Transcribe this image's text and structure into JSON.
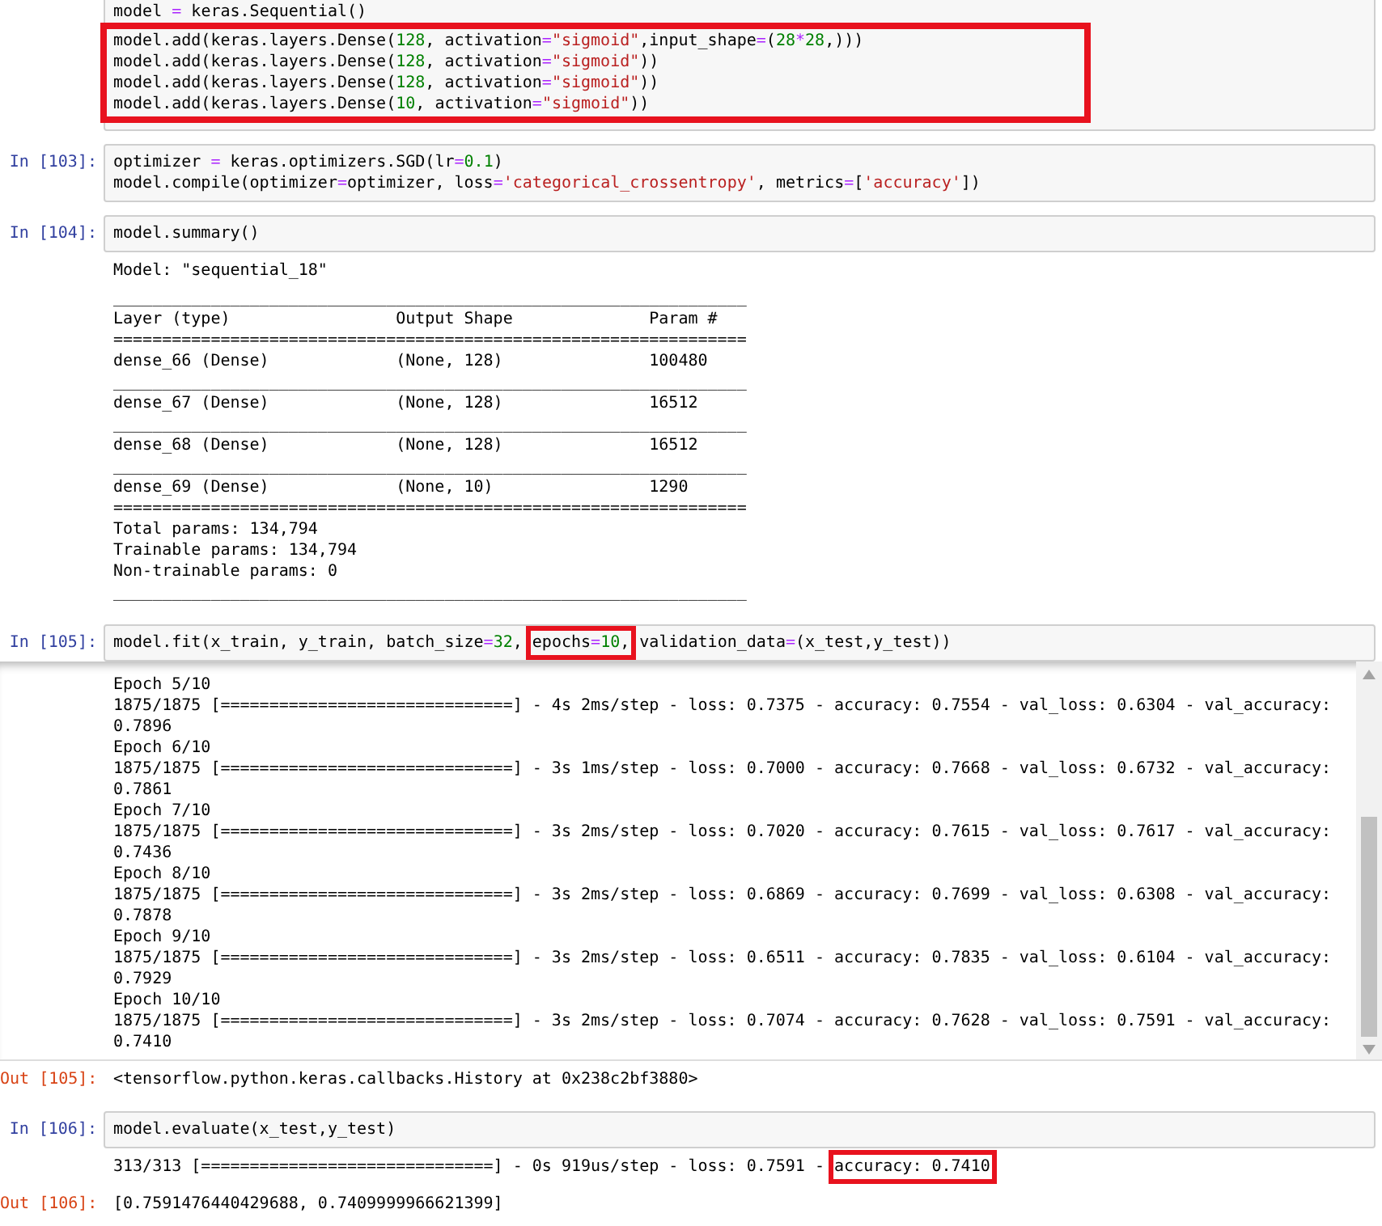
{
  "cells": [
    {
      "code": [
        {
          "highlighted": false,
          "segments": [
            {
              "text": "model ",
              "kind": "plain"
            },
            {
              "text": "=",
              "kind": "op"
            },
            {
              "text": " keras.Sequential()",
              "kind": "plain"
            }
          ]
        },
        {
          "highlighted": true,
          "segments": [
            {
              "text": "model.add(keras.layers.Dense(",
              "kind": "plain"
            },
            {
              "text": "128",
              "kind": "num"
            },
            {
              "text": ", activation",
              "kind": "plain"
            },
            {
              "text": "=",
              "kind": "op"
            },
            {
              "text": "\"sigmoid\"",
              "kind": "str"
            },
            {
              "text": ",input_shape",
              "kind": "plain"
            },
            {
              "text": "=",
              "kind": "op"
            },
            {
              "text": "(",
              "kind": "plain"
            },
            {
              "text": "28",
              "kind": "num"
            },
            {
              "text": "*",
              "kind": "op"
            },
            {
              "text": "28",
              "kind": "num"
            },
            {
              "text": ",)))",
              "kind": "plain"
            }
          ]
        },
        {
          "highlighted": true,
          "segments": [
            {
              "text": "model.add(keras.layers.Dense(",
              "kind": "plain"
            },
            {
              "text": "128",
              "kind": "num"
            },
            {
              "text": ", activation",
              "kind": "plain"
            },
            {
              "text": "=",
              "kind": "op"
            },
            {
              "text": "\"sigmoid\"",
              "kind": "str"
            },
            {
              "text": "))",
              "kind": "plain"
            }
          ]
        },
        {
          "highlighted": true,
          "segments": [
            {
              "text": "model.add(keras.layers.Dense(",
              "kind": "plain"
            },
            {
              "text": "128",
              "kind": "num"
            },
            {
              "text": ", activation",
              "kind": "plain"
            },
            {
              "text": "=",
              "kind": "op"
            },
            {
              "text": "\"sigmoid\"",
              "kind": "str"
            },
            {
              "text": "))",
              "kind": "plain"
            }
          ]
        },
        {
          "highlighted": true,
          "segments": [
            {
              "text": "model.add(keras.layers.Dense(",
              "kind": "plain"
            },
            {
              "text": "10",
              "kind": "num"
            },
            {
              "text": ", activation",
              "kind": "plain"
            },
            {
              "text": "=",
              "kind": "op"
            },
            {
              "text": "\"sigmoid\"",
              "kind": "str"
            },
            {
              "text": "))",
              "kind": "plain"
            }
          ]
        }
      ]
    },
    {
      "prompt": "In [103]:",
      "code": [
        {
          "highlighted": false,
          "segments": [
            {
              "text": "optimizer ",
              "kind": "plain"
            },
            {
              "text": "=",
              "kind": "op"
            },
            {
              "text": " keras.optimizers.SGD(lr",
              "kind": "plain"
            },
            {
              "text": "=",
              "kind": "op"
            },
            {
              "text": "0.1",
              "kind": "num"
            },
            {
              "text": ")",
              "kind": "plain"
            }
          ]
        },
        {
          "highlighted": false,
          "segments": [
            {
              "text": "model.compile(optimizer",
              "kind": "plain"
            },
            {
              "text": "=",
              "kind": "op"
            },
            {
              "text": "optimizer, loss",
              "kind": "plain"
            },
            {
              "text": "=",
              "kind": "op"
            },
            {
              "text": "'categorical_crossentropy'",
              "kind": "str"
            },
            {
              "text": ", metrics",
              "kind": "plain"
            },
            {
              "text": "=",
              "kind": "op"
            },
            {
              "text": "[",
              "kind": "plain"
            },
            {
              "text": "'accuracy'",
              "kind": "str"
            },
            {
              "text": "])",
              "kind": "plain"
            }
          ]
        }
      ]
    },
    {
      "prompt": "In [104]:",
      "code": [
        {
          "highlighted": false,
          "segments": [
            {
              "text": "model.summary()",
              "kind": "plain"
            }
          ]
        }
      ],
      "outputs": [
        {
          "kind": "stream",
          "lines": [
            "Model: \"sequential_18\"",
            "_________________________________________________________________",
            "Layer (type)                 Output Shape              Param #   ",
            "=================================================================",
            "dense_66 (Dense)             (None, 128)               100480    ",
            "_________________________________________________________________",
            "dense_67 (Dense)             (None, 128)               16512     ",
            "_________________________________________________________________",
            "dense_68 (Dense)             (None, 128)               16512     ",
            "_________________________________________________________________",
            "dense_69 (Dense)             (None, 10)                1290      ",
            "=================================================================",
            "Total params: 134,794",
            "Trainable params: 134,794",
            "Non-trainable params: 0",
            "_________________________________________________________________"
          ]
        }
      ]
    },
    {
      "prompt": "In [105]:",
      "code": [
        {
          "highlighted": false,
          "segments": [
            {
              "text": "model.fit(x_train, y_train, batch_size",
              "kind": "plain"
            },
            {
              "text": "=",
              "kind": "op"
            },
            {
              "text": "32",
              "kind": "num"
            },
            {
              "text": ", ",
              "kind": "plain"
            },
            {
              "kind": "box",
              "parts": [
                {
                  "text": "epochs",
                  "kind": "plain"
                },
                {
                  "text": "=",
                  "kind": "op"
                },
                {
                  "text": "10",
                  "kind": "num"
                },
                {
                  "text": ",",
                  "kind": "plain"
                }
              ]
            },
            {
              "text": " validation_data",
              "kind": "plain"
            },
            {
              "text": "=",
              "kind": "op"
            },
            {
              "text": "(x_test,y_test))",
              "kind": "plain"
            }
          ]
        }
      ],
      "outputs": [
        {
          "kind": "scrolled",
          "lines": [
            "Epoch 5/10",
            "1875/1875 [==============================] - 4s 2ms/step - loss: 0.7375 - accuracy: 0.7554 - val_loss: 0.6304 - val_accuracy:",
            "0.7896",
            "Epoch 6/10",
            "1875/1875 [==============================] - 3s 1ms/step - loss: 0.7000 - accuracy: 0.7668 - val_loss: 0.6732 - val_accuracy:",
            "0.7861",
            "Epoch 7/10",
            "1875/1875 [==============================] - 3s 2ms/step - loss: 0.7020 - accuracy: 0.7615 - val_loss: 0.7617 - val_accuracy:",
            "0.7436",
            "Epoch 8/10",
            "1875/1875 [==============================] - 3s 2ms/step - loss: 0.6869 - accuracy: 0.7699 - val_loss: 0.6308 - val_accuracy:",
            "0.7878",
            "Epoch 9/10",
            "1875/1875 [==============================] - 3s 2ms/step - loss: 0.6511 - accuracy: 0.7835 - val_loss: 0.6104 - val_accuracy:",
            "0.7929",
            "Epoch 10/10",
            "1875/1875 [==============================] - 3s 2ms/step - loss: 0.7074 - accuracy: 0.7628 - val_loss: 0.7591 - val_accuracy:",
            "0.7410"
          ]
        },
        {
          "kind": "result",
          "prompt": "Out [105]:",
          "lines": [
            "<tensorflow.python.keras.callbacks.History at 0x238c2bf3880>"
          ]
        }
      ]
    },
    {
      "prompt": "In [106]:",
      "code": [
        {
          "highlighted": false,
          "segments": [
            {
              "text": "model.evaluate(x_test,y_test)",
              "kind": "plain"
            }
          ]
        }
      ],
      "outputs": [
        {
          "kind": "rich",
          "segments": [
            {
              "text": "313/313 [==============================] - 0s 919us/step - loss: 0.7591 - ",
              "kind": "plain"
            },
            {
              "kind": "box",
              "parts": [
                {
                  "text": "accuracy: 0.7410",
                  "kind": "plain"
                }
              ]
            }
          ]
        },
        {
          "kind": "result",
          "prompt": "Out [106]:",
          "lines": [
            "[0.7591476440429688, 0.7409999966621399]"
          ]
        }
      ]
    }
  ]
}
